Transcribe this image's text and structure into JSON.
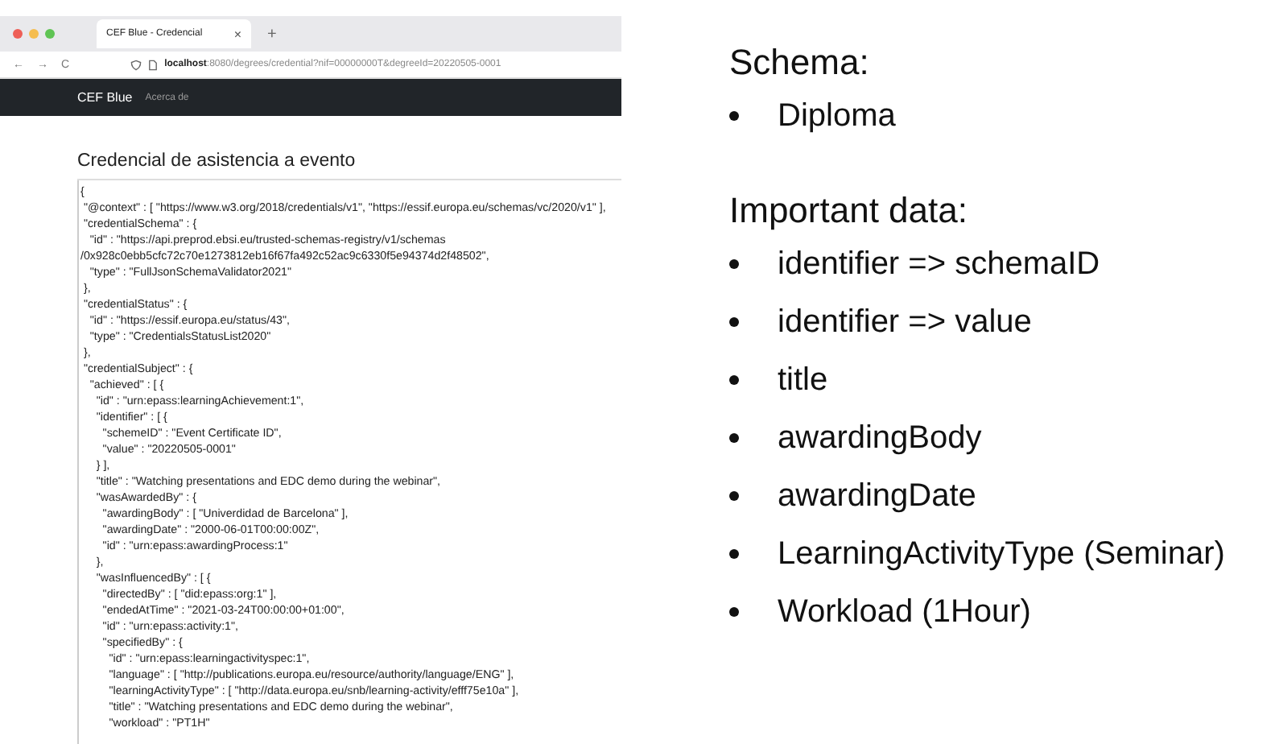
{
  "browser": {
    "tab": {
      "title": "CEF Blue - Credencial",
      "close": "×"
    },
    "new_tab": "+",
    "nav": {
      "back": "←",
      "forward": "→",
      "reload": "C"
    },
    "url": {
      "host": "localhost",
      "rest": ":8080/degrees/credential?nif=00000000T&degreeId=20220505-0001"
    },
    "navbar": {
      "brand": "CEF Blue",
      "links": [
        "Acerca de"
      ]
    },
    "heading": "Credencial de asistencia a evento",
    "code_lines": [
      "{",
      " \"@context\" : [ \"https://www.w3.org/2018/credentials/v1\", \"https://essif.europa.eu/schemas/vc/2020/v1\" ],",
      " \"credentialSchema\" : {",
      "   \"id\" : \"https://api.preprod.ebsi.eu/trusted-schemas-registry/v1/schemas",
      "/0x928c0ebb5cfc72c70e1273812eb16f67fa492c52ac9c6330f5e94374d2f48502\",",
      "   \"type\" : \"FullJsonSchemaValidator2021\"",
      " },",
      " \"credentialStatus\" : {",
      "   \"id\" : \"https://essif.europa.eu/status/43\",",
      "   \"type\" : \"CredentialsStatusList2020\"",
      " },",
      " \"credentialSubject\" : {",
      "   \"achieved\" : [ {",
      "     \"id\" : \"urn:epass:learningAchievement:1\",",
      "     \"identifier\" : [ {",
      "       \"schemeID\" : \"Event Certificate ID\",",
      "       \"value\" : \"20220505-0001\"",
      "     } ],",
      "     \"title\" : \"Watching presentations and EDC demo during the webinar\",",
      "     \"wasAwardedBy\" : {",
      "       \"awardingBody\" : [ \"Univerdidad de Barcelona\" ],",
      "       \"awardingDate\" : \"2000-06-01T00:00:00Z\",",
      "       \"id\" : \"urn:epass:awardingProcess:1\"",
      "     },",
      "     \"wasInfluencedBy\" : [ {",
      "       \"directedBy\" : [ \"did:epass:org:1\" ],",
      "       \"endedAtTime\" : \"2021-03-24T00:00:00+01:00\",",
      "       \"id\" : \"urn:epass:activity:1\",",
      "       \"specifiedBy\" : {",
      "         \"id\" : \"urn:epass:learningactivityspec:1\",",
      "         \"language\" : [ \"http://publications.europa.eu/resource/authority/language/ENG\" ],",
      "         \"learningActivityType\" : [ \"http://data.europa.eu/snb/learning-activity/efff75e10a\" ],",
      "         \"title\" : \"Watching presentations and EDC demo during the webinar\",",
      "         \"workload\" : \"PT1H\""
    ]
  },
  "notes": [
    {
      "heading": "Schema:",
      "bullets": [
        "Diploma"
      ]
    },
    {
      "heading": "Important data:",
      "bullets": [
        "identifier => schemaID",
        "identifier => value",
        "title",
        "awardingBody",
        "awardingDate",
        "LearningActivityType (Seminar)",
        "Workload (1Hour)"
      ]
    }
  ]
}
